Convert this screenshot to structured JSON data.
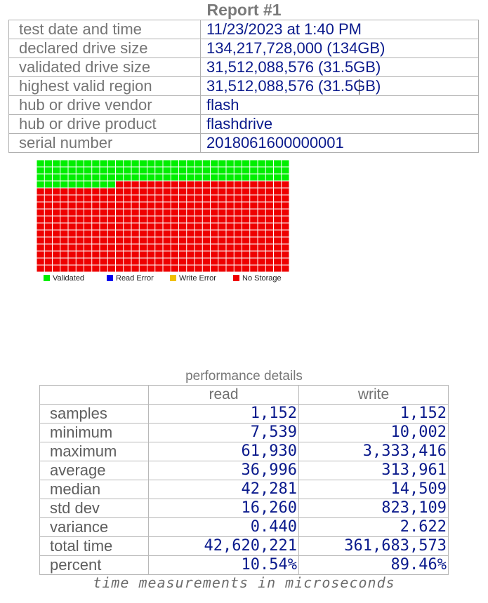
{
  "title": "Report #1",
  "info": [
    {
      "label": "test date and time",
      "value": "11/23/2023  at  1:40 PM"
    },
    {
      "label": "declared drive size",
      "value": "134,217,728,000  (134GB)"
    },
    {
      "label": "validated drive size",
      "value": "31,512,088,576  (31.5GB)"
    },
    {
      "label": "highest valid region",
      "value": "31,512,088,576  (31.5GB)"
    },
    {
      "label": "hub or drive vendor",
      "value": "flash"
    },
    {
      "label": "hub or drive product",
      "value": "flashdrive"
    },
    {
      "label": "serial number",
      "value": "2018061600000001"
    }
  ],
  "grid": {
    "columns": 32,
    "rows": 16,
    "validated_cells": 106,
    "colors": {
      "validated": "#00ee00",
      "read_error": "#0000ee",
      "write_error": "#f0c000",
      "no_storage": "#ee0000"
    }
  },
  "legend": {
    "validated": "Validated",
    "read_error": "Read Error",
    "write_error": "Write Error",
    "no_storage": "No Storage"
  },
  "performance": {
    "caption": "performance details",
    "columns": [
      "read",
      "write"
    ],
    "rows": [
      {
        "label": "samples",
        "read": "1,152",
        "write": "1,152"
      },
      {
        "label": "minimum",
        "read": "7,539",
        "write": "10,002"
      },
      {
        "label": "maximum",
        "read": "61,930",
        "write": "3,333,416"
      },
      {
        "label": "average",
        "read": "36,996",
        "write": "313,961"
      },
      {
        "label": "median",
        "read": "42,281",
        "write": "14,509"
      },
      {
        "label": "std dev",
        "read": "16,260",
        "write": "823,109"
      },
      {
        "label": "variance",
        "read": "0.440",
        "write": "2.622"
      },
      {
        "label": "total time",
        "read": "42,620,221",
        "write": "361,683,573"
      },
      {
        "label": "percent",
        "read": "10.54%",
        "write": "89.46%"
      }
    ],
    "footnote": "time measurements in microseconds"
  }
}
